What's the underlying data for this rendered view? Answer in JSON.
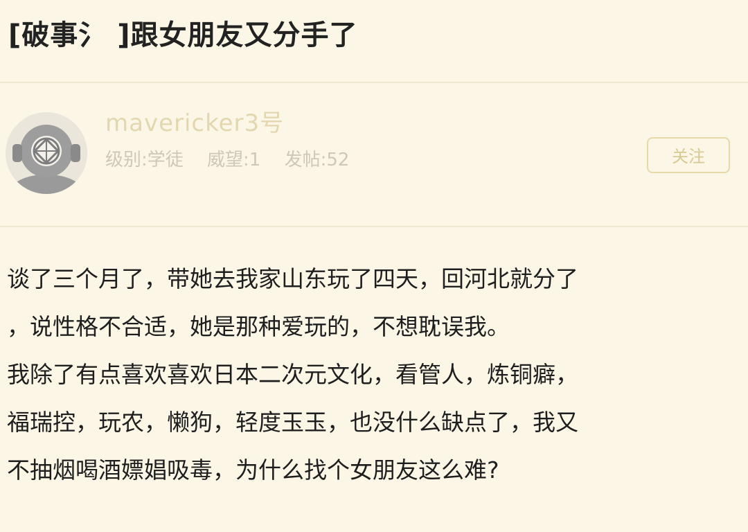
{
  "post": {
    "title": "[破事氵 ]跟女朋友又分手了"
  },
  "author": {
    "username": "mavericker3号",
    "level_label": "级别:学徒",
    "prestige_label": "威望:1",
    "posts_label": "发帖:52",
    "avatar_icon": "diving-helmet-icon"
  },
  "follow_button": {
    "label": "关注"
  },
  "body": {
    "lines": [
      "谈了三个月了，带她去我家山东玩了四天，回河北就分了",
      "，说性格不合适，她是那种爱玩的，不想耽误我。",
      "我除了有点喜欢喜欢日本二次元文化，看管人，炼铜癖，",
      "福瑞控，玩农，懒狗，轻度玉玉，也没什么缺点了，我又",
      "不抽烟喝酒嫖娼吸毒，为什么找个女朋友这么难?"
    ]
  },
  "colors": {
    "background": "#fbf6e6",
    "username": "#e3d7b0",
    "meta": "#cfc8b7",
    "button_border": "#e6d9a8"
  }
}
